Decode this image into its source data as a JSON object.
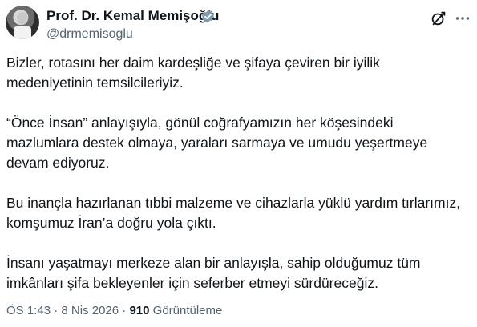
{
  "author": {
    "name": "Prof. Dr. Kemal Memişoğlu",
    "handle": "@drmemisoglu",
    "verified": true,
    "verified_color": "#829aab"
  },
  "header_actions": {
    "grok_icon": "grok-icon",
    "more_icon": "more-icon"
  },
  "tweet": {
    "paragraphs": [
      "Bizler, rotasını her daim kardeşliğe ve şifaya çeviren bir iyilik\nmedeniyetinin temsilcileriyiz.",
      "“Önce İnsan” anlayışıyla, gönül coğrafyamızın her köşesindeki\nmazlumlara destek olmaya, yaraları sarmaya ve umudu yeşertmeye\ndevam ediyoruz.",
      "Bu inançla hazırlanan tıbbi malzeme ve cihazlarla yüklü yardım tırlarımız,\nkomşumuz İran’a doğru yola çıktı.",
      "İnsanı yaşatmayı merkeze alan bir anlayışla, sahip olduğumuz tüm\nimkânları şifa bekleyenler için seferber etmeyi sürdüreceğiz."
    ]
  },
  "meta": {
    "time": "ÖS 1:43",
    "separator": " · ",
    "date": "8 Nis 2026",
    "views_count": "910",
    "views_label": " Görüntüleme"
  }
}
